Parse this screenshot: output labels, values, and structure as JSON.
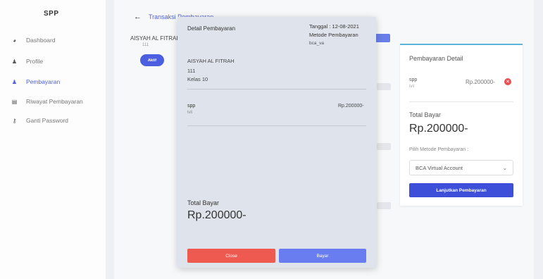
{
  "sidebar": {
    "brand": "SPP",
    "items": [
      {
        "label": "Dashboard",
        "icon": "dashboard-icon",
        "glyph": "◕"
      },
      {
        "label": "Profile",
        "icon": "user-icon",
        "glyph": "♟"
      },
      {
        "label": "Pembayaran",
        "icon": "user-icon",
        "glyph": "♟"
      },
      {
        "label": "Riwayat Pembayaran",
        "icon": "document-icon",
        "glyph": "▤"
      },
      {
        "label": "Ganti Password",
        "icon": "key-icon",
        "glyph": "⚷"
      }
    ],
    "active_index": 2
  },
  "header": {
    "back_glyph": "←",
    "title": "Transaksi Pembayaran"
  },
  "student": {
    "name": "AISYAH AL FITRAH",
    "nis": "111",
    "status": "Aktif"
  },
  "right_panel": {
    "title": "Pembayaran Detail",
    "item_name": "spp",
    "item_sub": "lvli",
    "item_amount": "Rp.200000-",
    "remove_glyph": "✕",
    "total_label": "Total Bayar",
    "total_value": "Rp.200000-",
    "method_label": "Pilih Metode Pembayaran :",
    "method_value": "BCA Virtual Account",
    "chevron": "⌄",
    "button": "Lanjutkan Pembayaran"
  },
  "modal": {
    "title": "Detail Pembayaran",
    "date": "Tanggal : 12-08-2021",
    "method_label": "Metode Pembayaran",
    "method_value": "bca_va",
    "name": "AISYAH AL FITRAH",
    "nis": "111",
    "kelas": "Kelas 10",
    "item": "spp",
    "item_sub": "lvli",
    "item_amount": "Rp.200000-",
    "total_label": "Total Bayar",
    "total_value": "Rp.200000-",
    "close_button": "Close",
    "pay_button": "Bayar"
  },
  "colors": {
    "accent": "#4c5fe0",
    "close": "#ee5a4f",
    "pay": "#6a7df0",
    "panel_border": "#5bb5d9"
  }
}
